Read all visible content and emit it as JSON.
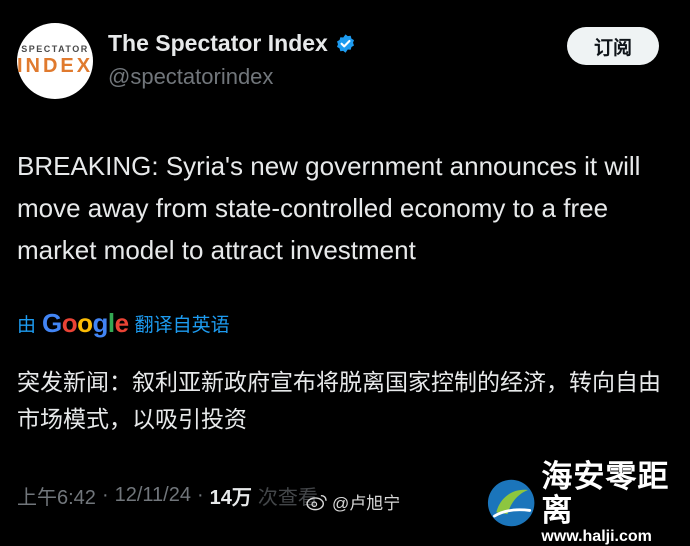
{
  "profile": {
    "avatar_line1": "SPECTATOR",
    "avatar_line2": "INDEX",
    "name": "The Spectator Index",
    "verified_icon": "verified-badge-icon",
    "handle": "@spectatorindex",
    "subscribe_label": "订阅"
  },
  "tweet": {
    "text": "BREAKING: Syria's new government announces it will move away from state-controlled economy to a free market model to attract investment"
  },
  "translation": {
    "prefix": "由",
    "provider": "Google",
    "suffix": "翻译自英语",
    "text": "突发新闻：叙利亚新政府宣布将脱离国家控制的经济，转向自由市场模式，以吸引投资"
  },
  "meta": {
    "time": "上午6:42",
    "separator": "·",
    "date": "12/11/24",
    "views_count": "14万",
    "views_label": "次查看"
  },
  "weibo_watermark": {
    "icon": "weibo-icon",
    "text": "@卢旭宁"
  },
  "site_watermark": {
    "title": "海安零距离",
    "url": "www.halji.com"
  },
  "colors": {
    "background": "#000000",
    "text": "#e7e9ea",
    "muted": "#71767b",
    "link": "#1d9bf0",
    "verified": "#1d9bf0",
    "avatar_accent": "#e07a2e"
  }
}
